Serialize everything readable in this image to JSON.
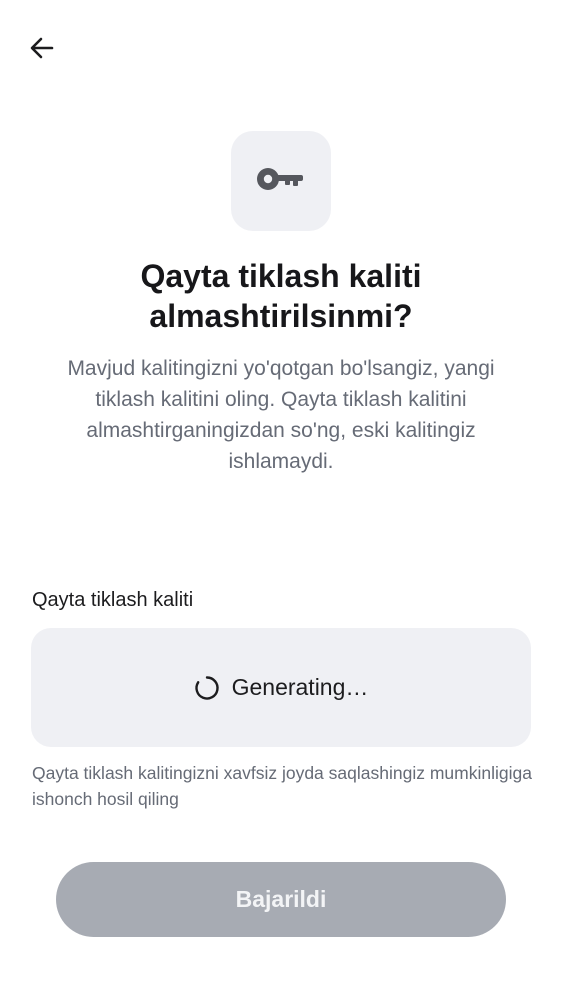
{
  "header": {
    "back_icon": "arrow-left-icon"
  },
  "hero": {
    "icon": "key-icon"
  },
  "title": "Qayta tiklash kaliti almashtirilsinmi?",
  "subtitle": "Mavjud kalitingizni yo'qotgan bo'lsangiz, yangi tiklash kalitini oling. Qayta tiklash kalitini almashtirganingizdan so'ng, eski kalitingiz ishlamaydi.",
  "field": {
    "label": "Qayta tiklash kaliti",
    "status": "Generating…",
    "status_icon": "spinner-icon"
  },
  "hint": "Qayta tiklash kalitingizni xavfsiz joyda saqlashingiz mumkinligiga ishonch hosil qiling",
  "button": {
    "label": "Bajarildi",
    "enabled": false
  },
  "colors": {
    "icon_tile": "#eff0f4",
    "button_disabled": "#a7abb3",
    "text_primary": "#17171a",
    "text_secondary": "#666b76"
  }
}
